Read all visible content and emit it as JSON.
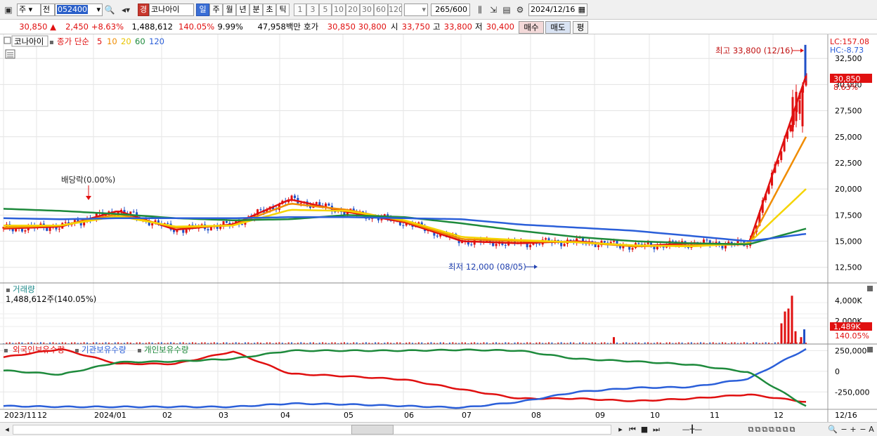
{
  "toolbar": {
    "market_type": "주",
    "market_prev": "전",
    "code": "052400",
    "stock_name": "코나아이",
    "badge": "경",
    "periods": [
      "일",
      "주",
      "월",
      "년",
      "분",
      "초",
      "틱"
    ],
    "intervals": [
      "1",
      "3",
      "5",
      "10",
      "20",
      "30",
      "60",
      "120"
    ],
    "count": "265",
    "count_max": "/600",
    "date": "2024/12/16"
  },
  "quote": {
    "price": "30,850",
    "arrow": "▲",
    "change": "2,450",
    "change_pct": "+8.63%",
    "volume": "1,488,612",
    "volume_ratio": "140.05%",
    "turnover": "9.99%",
    "amount": "47,958백만",
    "hoga_label": "호가",
    "hoga1": "30,850",
    "hoga2": "30,800",
    "open_label": "시",
    "open": "33,750",
    "high_label": "고",
    "high": "33,800",
    "low_label": "저",
    "low": "30,400",
    "buy": "매수",
    "sell": "매도",
    "eval": "평"
  },
  "price_panel": {
    "name": "코나아이",
    "series_label": "종가 단순",
    "ma": [
      {
        "label": "5",
        "color": "#e01010"
      },
      {
        "label": "10",
        "color": "#f08c00"
      },
      {
        "label": "20",
        "color": "#f5d400"
      },
      {
        "label": "60",
        "color": "#1e8a3c"
      },
      {
        "label": "120",
        "color": "#2b5fd9"
      }
    ],
    "lc": "LC:157.08",
    "hc": "HC:-8.73",
    "yticks": [
      "32,500",
      "30,000",
      "27,500",
      "25,000",
      "22,500",
      "20,000",
      "17,500",
      "15,000",
      "12,500"
    ],
    "price_tag": "30,850",
    "pct_tag": "8.63%",
    "high_note": "최고 33,800 (12/16)",
    "low_note": "최저 12,000 (08/05)",
    "dividend_note": "배당락(0.00%)"
  },
  "volume_panel": {
    "title": "거래량",
    "value": "1,488,612주(140.05%)",
    "yticks": [
      "4,000K",
      "2,000K"
    ],
    "vol_tag": "1,489K",
    "pct_tag": "140.05%"
  },
  "holder_panel": {
    "labels": [
      "외국인보유수량",
      "기관보유수량",
      "개인보유수량"
    ],
    "colors": [
      "#e01010",
      "#2b5fd9",
      "#1e8a3c"
    ],
    "yticks": [
      "250,000",
      "0",
      "-250,000"
    ]
  },
  "xaxis": {
    "labels": [
      "2023/11",
      "12",
      "2024/01",
      "02",
      "03",
      "04",
      "05",
      "06",
      "07",
      "08",
      "09",
      "10",
      "11",
      "12"
    ],
    "right_label": "12/16"
  },
  "colors": {
    "up": "#e01010",
    "down": "#2050c8",
    "grid": "#d0d0d0"
  },
  "chart_data": {
    "type": "candlestick",
    "x": [
      "2023/11",
      "12",
      "2024/01",
      "02",
      "03",
      "04",
      "05",
      "06",
      "07",
      "08",
      "09",
      "10",
      "11",
      "12"
    ],
    "ylim": [
      11000,
      34800
    ],
    "ma_series": [
      {
        "name": "5",
        "color": "#e01010",
        "values": [
          16200,
          16400,
          17900,
          16100,
          16600,
          19000,
          17800,
          16800,
          15000,
          14800,
          15000,
          14500,
          14800,
          14700,
          30850
        ]
      },
      {
        "name": "10",
        "color": "#f08c00",
        "values": [
          16300,
          16500,
          17600,
          16300,
          16500,
          18600,
          18000,
          16900,
          15200,
          15000,
          14900,
          14500,
          14600,
          14700,
          25000
        ]
      },
      {
        "name": "20",
        "color": "#f5d400",
        "values": [
          16500,
          16500,
          17400,
          16400,
          16500,
          18000,
          17900,
          17000,
          15400,
          15100,
          14900,
          14600,
          14500,
          14800,
          20000
        ]
      },
      {
        "name": "60",
        "color": "#1e8a3c",
        "values": [
          18100,
          17900,
          17600,
          17200,
          17000,
          17100,
          17500,
          17300,
          16700,
          16000,
          15400,
          15000,
          14800,
          14700,
          16200
        ]
      },
      {
        "name": "120",
        "color": "#2b5fd9",
        "values": [
          17200,
          17100,
          17200,
          17200,
          17200,
          17300,
          17300,
          17200,
          17100,
          16600,
          16300,
          16000,
          15500,
          15000,
          15700
        ]
      }
    ],
    "volume_peaks": [
      {
        "x": "12",
        "value": 4900000
      },
      {
        "x": "12/16",
        "value": 1488612
      }
    ],
    "holders": [
      {
        "name": "외국인보유수량",
        "color": "#e01010",
        "values": [
          170000,
          270000,
          90000,
          90000,
          240000,
          -30000,
          -60000,
          -100000,
          -220000,
          -330000,
          -330000,
          -360000,
          -330000,
          -280000,
          -370000
        ]
      },
      {
        "name": "기관보유수량",
        "color": "#2b5fd9",
        "values": [
          -420000,
          -430000,
          -430000,
          -430000,
          -430000,
          -390000,
          -400000,
          -420000,
          -440000,
          -370000,
          -250000,
          -200000,
          -190000,
          -90000,
          270000
        ]
      },
      {
        "name": "개인보유수량",
        "color": "#1e8a3c",
        "values": [
          10000,
          -40000,
          110000,
          120000,
          150000,
          250000,
          250000,
          250000,
          260000,
          250000,
          150000,
          120000,
          80000,
          -10000,
          -420000
        ]
      }
    ]
  }
}
